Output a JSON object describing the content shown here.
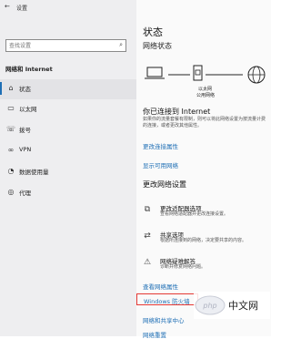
{
  "window": {
    "back_glyph": "←",
    "title": "设置"
  },
  "search": {
    "placeholder": "查找设置"
  },
  "sidebar": {
    "section_label": "网络和 Internet",
    "items": [
      {
        "icon": "home-icon",
        "label": "状态"
      },
      {
        "icon": "ethernet-icon",
        "label": "以太网"
      },
      {
        "icon": "dialup-icon",
        "label": "拨号"
      },
      {
        "icon": "vpn-icon",
        "label": "VPN"
      },
      {
        "icon": "data-usage-icon",
        "label": "数据使用量"
      },
      {
        "icon": "proxy-icon",
        "label": "代理"
      }
    ]
  },
  "main": {
    "title": "状态",
    "network_status_heading": "网络状态",
    "diagram": {
      "adapter_label": "以太网",
      "network_label": "公用网络"
    },
    "connected_heading": "你已连接到 Internet",
    "connected_desc": "如果你的流量套餐有限制，则可以将此网络设置为按流量计费的连接，或者更改其他属性。",
    "link_change_connection": "更改连接属性",
    "link_show_networks": "显示可用网络",
    "change_settings_heading": "更改网络设置",
    "options": [
      {
        "icon": "adapter-icon",
        "title": "更改适配器选项",
        "desc": "查看网络适配器并更改连接设置。"
      },
      {
        "icon": "sharing-icon",
        "title": "共享选项",
        "desc": "根据所连接到的网络，决定要共享的内容。"
      },
      {
        "icon": "warning-icon",
        "title": "网络疑难解答",
        "desc": "诊断并修复网络问题。"
      }
    ],
    "link_hardware": "查看网络属性",
    "link_firewall": "Windows 防火墙",
    "link_sharing_center": "网络和共享中心",
    "link_reset": "网络重置"
  },
  "watermark": {
    "text": "中文网"
  },
  "colors": {
    "accent": "#1f6fb5",
    "highlight": "#e53935",
    "sidebar_bg": "#eeeef0"
  }
}
